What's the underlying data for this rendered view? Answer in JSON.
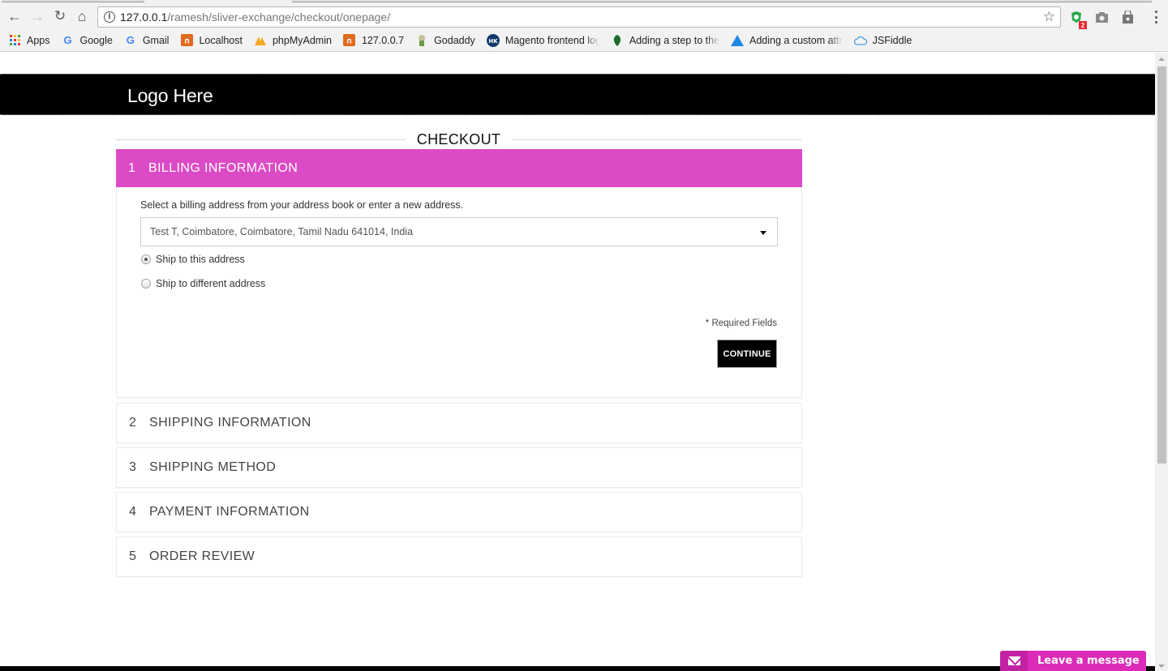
{
  "browser": {
    "url_host": "127.0.0.1",
    "url_path": "/ramesh/sliver-exchange/checkout/onepage/",
    "extension_badge_count": "2",
    "bookmarks": [
      {
        "label": "Apps",
        "icon": "apps-grid-icon"
      },
      {
        "label": "Google",
        "icon": "google-icon"
      },
      {
        "label": "Gmail",
        "icon": "google-icon"
      },
      {
        "label": "Localhost",
        "icon": "xampp-icon"
      },
      {
        "label": "phpMyAdmin",
        "icon": "phpmyadmin-icon"
      },
      {
        "label": "127.0.0.7",
        "icon": "xampp-icon"
      },
      {
        "label": "Godaddy",
        "icon": "godaddy-icon"
      },
      {
        "label": "Magento frontend log",
        "icon": "hk-icon"
      },
      {
        "label": "Adding a step to the",
        "icon": "leaf-icon"
      },
      {
        "label": "Adding a custom attr",
        "icon": "triangle-icon"
      },
      {
        "label": "JSFiddle",
        "icon": "jsfiddle-cloud-icon"
      }
    ]
  },
  "header": {
    "logo_text": "Logo Here"
  },
  "page": {
    "title": "CHECKOUT"
  },
  "steps": [
    {
      "number": "1",
      "title": "BILLING INFORMATION",
      "active": true
    },
    {
      "number": "2",
      "title": "SHIPPING INFORMATION",
      "active": false
    },
    {
      "number": "3",
      "title": "SHIPPING METHOD",
      "active": false
    },
    {
      "number": "4",
      "title": "PAYMENT INFORMATION",
      "active": false
    },
    {
      "number": "5",
      "title": "ORDER REVIEW",
      "active": false
    }
  ],
  "billing": {
    "instruction": "Select a billing address from your address book or enter a new address.",
    "selected_address": "Test T, Coimbatore, Coimbatore, Tamil Nadu 641014, India",
    "ship_options": [
      {
        "label": "Ship to this address",
        "checked": true
      },
      {
        "label": "Ship to different address",
        "checked": false
      }
    ],
    "required_note": "Required Fields",
    "required_marker": "*",
    "continue_label": "CONTINUE"
  },
  "chat": {
    "label": "Leave a message"
  },
  "colors": {
    "accent": "#dc4bc6",
    "chat": "#db2bb8",
    "header_bg": "#000000"
  }
}
